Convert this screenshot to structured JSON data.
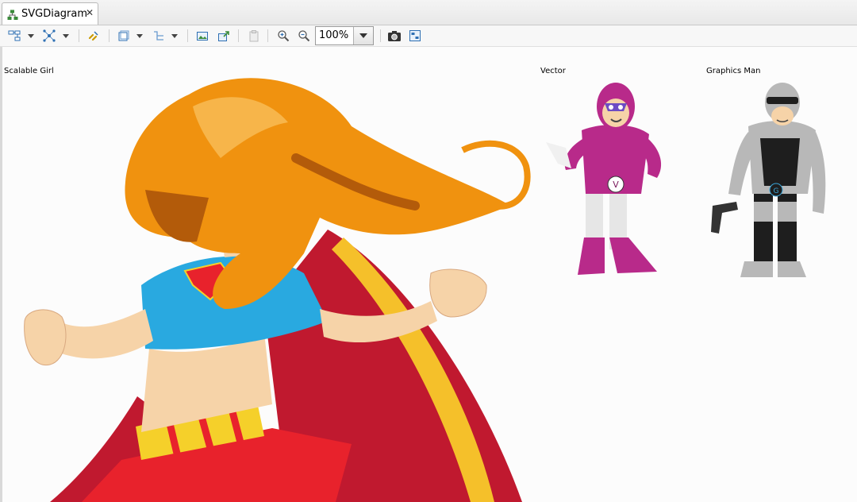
{
  "editor": {
    "tab_label": "SVGDiagram",
    "tab_icon": "diagram-icon",
    "close_icon": "close-icon"
  },
  "toolbar": {
    "zoom_value": "100%",
    "icons": [
      "select-layout-icon",
      "arrange-icon",
      "link-icon",
      "shape-icon",
      "route-icon",
      "image-icon",
      "export-icon",
      "paste-icon",
      "zoom-in-icon",
      "zoom-out-icon",
      "screenshot-icon",
      "properties-icon"
    ]
  },
  "figures": [
    {
      "name": "Scalable Girl"
    },
    {
      "name": "Vector"
    },
    {
      "name": "Graphics Man"
    }
  ],
  "colors": {
    "hair": "#f0920f",
    "top": "#29a9e0",
    "cape": "#c0192f",
    "skirt": "#e8222c",
    "belt": "#f5d02a",
    "vector_suit": "#b82a8a",
    "robot_silver": "#b8b8b8",
    "robot_dark": "#1e1e1e"
  }
}
